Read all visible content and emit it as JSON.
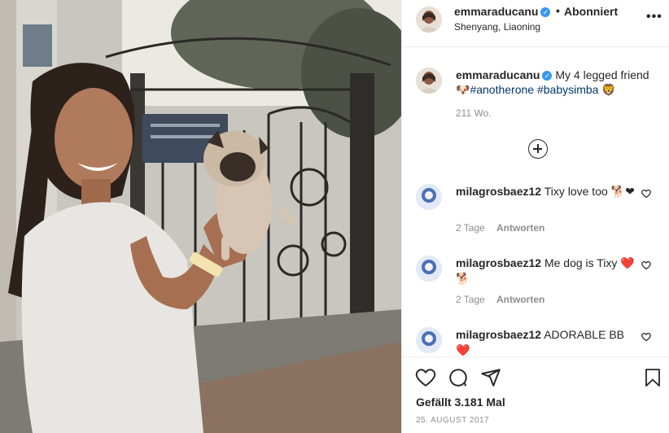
{
  "post": {
    "photo_alt_icon": "photo",
    "header": {
      "username": "emmaraducanu",
      "verified_icon": "verified-badge",
      "separator": "•",
      "follow_status": "Abonniert",
      "location": "Shenyang, Liaoning",
      "more_icon": "more-icon",
      "more_glyph": "•••"
    },
    "caption": {
      "username": "emmaraducanu",
      "text_before": "My 4 legged friend🐶",
      "hashtag1": "#anotherone",
      "hashtag2": "#babysimba",
      "emoji_end": "🦁",
      "time": "211 Wo."
    },
    "load_more_icon": "plus-circle-icon",
    "comments": [
      {
        "username": "milagrosbaez12",
        "text": "Tixy love too 🐕❤",
        "time": "2 Tage",
        "reply": "Antworten"
      },
      {
        "username": "milagrosbaez12",
        "text": "Me dog is Tixy ❤️🐕",
        "time": "2 Tage",
        "reply": "Antworten"
      },
      {
        "username": "milagrosbaez12",
        "text": "ADORABLE BB ❤️",
        "time": "",
        "reply": ""
      }
    ],
    "actions": {
      "likes": "Gefällt 3.181 Mal",
      "date": "25. AUGUST 2017"
    },
    "colors": {
      "verified": "#3897f0",
      "hashtag": "#00376b",
      "muted": "#8e8e8e",
      "text": "#262626"
    }
  }
}
